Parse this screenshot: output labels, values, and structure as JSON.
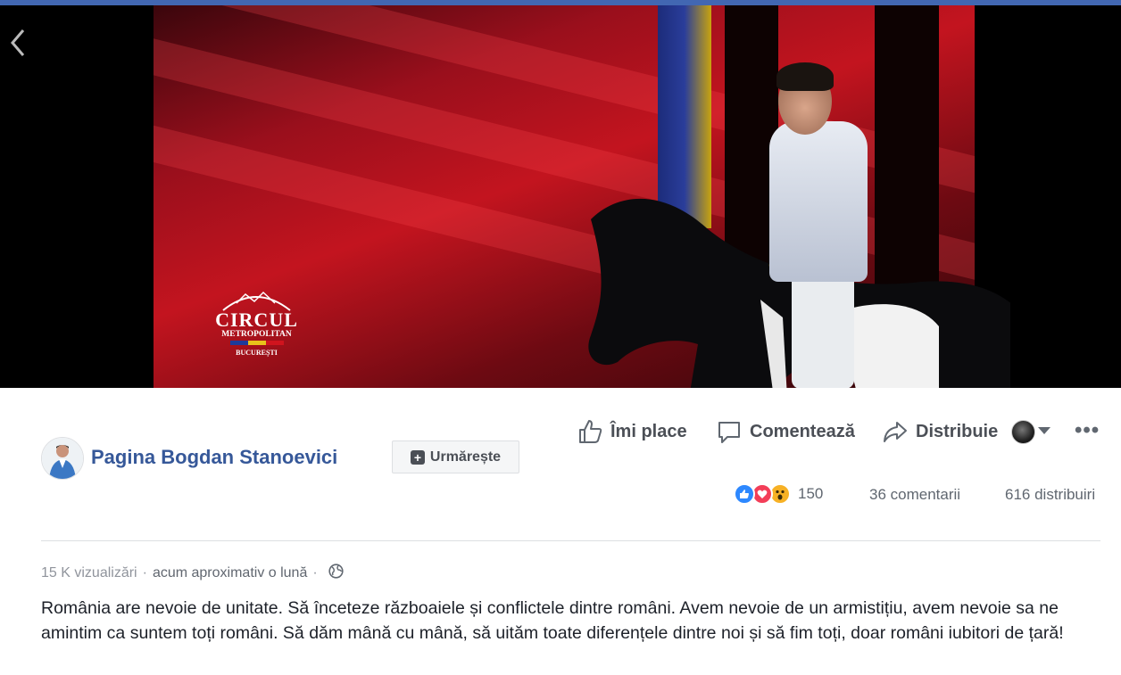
{
  "video": {
    "watermark": {
      "line1": "CIRCUL",
      "line2": "METROPOLITAN",
      "line3": "BUCUREȘTI"
    }
  },
  "page": {
    "name": "Pagina Bogdan Stanoevici",
    "follow_label": "Urmărește"
  },
  "actions": {
    "like_label": "Îmi place",
    "comment_label": "Comentează",
    "share_label": "Distribuie",
    "more_label": "•••"
  },
  "stats": {
    "reaction_count": "150",
    "comments": "36 comentarii",
    "shares": "616 distribuiri",
    "reaction_icons": [
      "like-icon",
      "love-icon",
      "wow-icon"
    ]
  },
  "meta": {
    "views": "15 K vizualizări",
    "separator": "·",
    "time": "acum aproximativ o lună",
    "privacy_icon": "globe-icon"
  },
  "post": {
    "text": "România are nevoie de unitate. Să înceteze războaiele și conflictele dintre români. Avem nevoie de un armistițiu, avem nevoie sa ne amintim ca suntem toți români. Să dăm mână cu mână, să uităm toate diferențele dintre noi și să fim toți, doar români iubitori de țară!"
  },
  "colors": {
    "link_blue": "#365899",
    "top_bar": "#4267b2",
    "secondary_text": "#606770"
  }
}
